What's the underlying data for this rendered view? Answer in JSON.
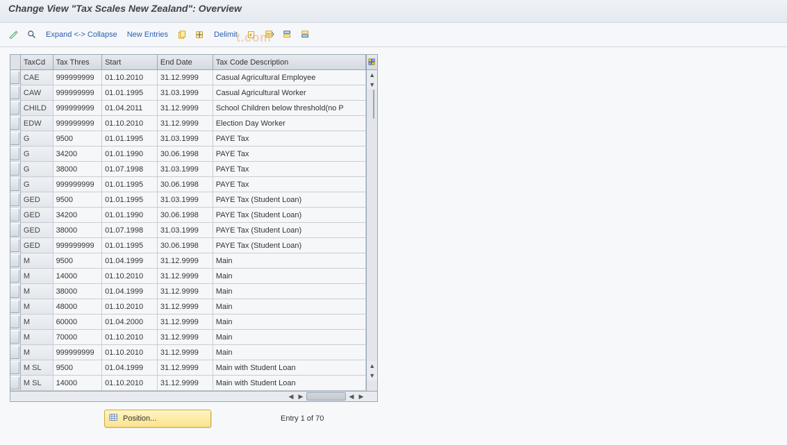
{
  "page_title": "Change View \"Tax Scales New Zealand\": Overview",
  "watermark_text": "t.com",
  "toolbar": {
    "expand_collapse_label": "Expand <-> Collapse",
    "new_entries_label": "New Entries",
    "delimit_label": "Delimit"
  },
  "columns": {
    "taxcd": "TaxCd",
    "taxthres": "Tax Thres",
    "start": "Start",
    "end": "End Date",
    "desc": "Tax Code Description"
  },
  "col_widths": {
    "taxcd": 38,
    "taxthres": 62,
    "start": 72,
    "end": 72,
    "desc": 223
  },
  "rows": [
    {
      "code": "CAE",
      "thres": "999999999",
      "start": "01.10.2010",
      "end": "31.12.9999",
      "desc": "Casual Agricultural Employee"
    },
    {
      "code": "CAW",
      "thres": "999999999",
      "start": "01.01.1995",
      "end": "31.03.1999",
      "desc": "Casual Agricultural Worker"
    },
    {
      "code": "CHILD",
      "thres": "999999999",
      "start": "01.04.2011",
      "end": "31.12.9999",
      "desc": "School Children below threshold(no P"
    },
    {
      "code": "EDW",
      "thres": "999999999",
      "start": "01.10.2010",
      "end": "31.12.9999",
      "desc": "Election Day Worker"
    },
    {
      "code": "G",
      "thres": "9500",
      "start": "01.01.1995",
      "end": "31.03.1999",
      "desc": "PAYE Tax"
    },
    {
      "code": "G",
      "thres": "34200",
      "start": "01.01.1990",
      "end": "30.06.1998",
      "desc": "PAYE Tax"
    },
    {
      "code": "G",
      "thres": "38000",
      "start": "01.07.1998",
      "end": "31.03.1999",
      "desc": "PAYE Tax"
    },
    {
      "code": "G",
      "thres": "999999999",
      "start": "01.01.1995",
      "end": "30.06.1998",
      "desc": "PAYE Tax"
    },
    {
      "code": "GED",
      "thres": "9500",
      "start": "01.01.1995",
      "end": "31.03.1999",
      "desc": "PAYE Tax (Student Loan)"
    },
    {
      "code": "GED",
      "thres": "34200",
      "start": "01.01.1990",
      "end": "30.06.1998",
      "desc": "PAYE Tax (Student Loan)"
    },
    {
      "code": "GED",
      "thres": "38000",
      "start": "01.07.1998",
      "end": "31.03.1999",
      "desc": "PAYE Tax (Student Loan)"
    },
    {
      "code": "GED",
      "thres": "999999999",
      "start": "01.01.1995",
      "end": "30.06.1998",
      "desc": "PAYE Tax (Student Loan)"
    },
    {
      "code": "M",
      "thres": "9500",
      "start": "01.04.1999",
      "end": "31.12.9999",
      "desc": "Main"
    },
    {
      "code": "M",
      "thres": "14000",
      "start": "01.10.2010",
      "end": "31.12.9999",
      "desc": "Main"
    },
    {
      "code": "M",
      "thres": "38000",
      "start": "01.04.1999",
      "end": "31.12.9999",
      "desc": "Main"
    },
    {
      "code": "M",
      "thres": "48000",
      "start": "01.10.2010",
      "end": "31.12.9999",
      "desc": "Main"
    },
    {
      "code": "M",
      "thres": "60000",
      "start": "01.04.2000",
      "end": "31.12.9999",
      "desc": "Main"
    },
    {
      "code": "M",
      "thres": "70000",
      "start": "01.10.2010",
      "end": "31.12.9999",
      "desc": "Main"
    },
    {
      "code": "M",
      "thres": "999999999",
      "start": "01.10.2010",
      "end": "31.12.9999",
      "desc": "Main"
    },
    {
      "code": "M SL",
      "thres": "9500",
      "start": "01.04.1999",
      "end": "31.12.9999",
      "desc": "Main with Student Loan"
    },
    {
      "code": "M SL",
      "thres": "14000",
      "start": "01.10.2010",
      "end": "31.12.9999",
      "desc": "Main with Student Loan"
    }
  ],
  "footer": {
    "position_label": "Position...",
    "entry_text": "Entry 1 of 70"
  }
}
